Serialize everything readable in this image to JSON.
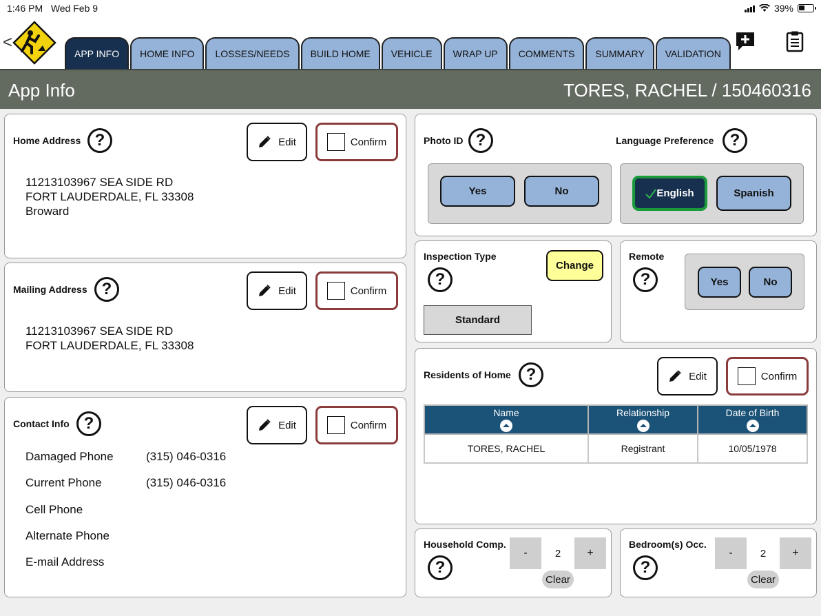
{
  "status": {
    "time": "1:46 PM",
    "date": "Wed Feb 9",
    "battery": "39%"
  },
  "nav": {
    "back": "<",
    "tabs": [
      "APP INFO",
      "HOME INFO",
      "LOSSES/NEEDS",
      "BUILD HOME",
      "VEHICLE",
      "WRAP UP",
      "COMMENTS",
      "SUMMARY",
      "VALIDATION"
    ],
    "active_tab": "APP INFO",
    "icons": [
      "add-comment-icon",
      "clipboard-icon"
    ]
  },
  "header": {
    "title": "App Info",
    "person": "TORES, RACHEL / 150460316"
  },
  "common": {
    "edit": "Edit",
    "confirm": "Confirm",
    "help": "?"
  },
  "home_address": {
    "label": "Home Address",
    "line1": "11213103967 SEA SIDE RD",
    "line2": "FORT LAUDERDALE, FL 33308",
    "line3": "Broward"
  },
  "mailing_address": {
    "label": "Mailing Address",
    "line1": "11213103967 SEA SIDE RD",
    "line2": "FORT LAUDERDALE, FL 33308"
  },
  "contact": {
    "label": "Contact Info",
    "rows": [
      {
        "label": "Damaged Phone",
        "value": "(315) 046-0316"
      },
      {
        "label": "Current Phone",
        "value": "(315) 046-0316"
      },
      {
        "label": "Cell Phone",
        "value": ""
      },
      {
        "label": "Alternate Phone",
        "value": ""
      },
      {
        "label": "E-mail Address",
        "value": ""
      }
    ]
  },
  "photo_id": {
    "label": "Photo ID",
    "yes": "Yes",
    "no": "No"
  },
  "language": {
    "label": "Language Preference",
    "english": "English",
    "spanish": "Spanish",
    "selected": "English"
  },
  "inspection": {
    "label": "Inspection Type",
    "change": "Change",
    "value": "Standard"
  },
  "remote": {
    "label": "Remote",
    "yes": "Yes",
    "no": "No"
  },
  "residents": {
    "label": "Residents of Home",
    "columns": [
      "Name",
      "Relationship",
      "Date of Birth"
    ],
    "rows": [
      [
        "TORES, RACHEL",
        "Registrant",
        "10/05/1978"
      ]
    ]
  },
  "household": {
    "label": "Household Comp.",
    "minus": "-",
    "value": "2",
    "plus": "+",
    "clear": "Clear"
  },
  "bedrooms": {
    "label": "Bedroom(s) Occ.",
    "minus": "-",
    "value": "2",
    "plus": "+",
    "clear": "Clear"
  },
  "colors": {
    "tab": "#95b3d8",
    "tab_active": "#17304f",
    "header": "#636b61",
    "confirm_border": "#8a3b3b",
    "table_header": "#1b5277",
    "selected_border": "#1a9a3a",
    "change": "#ffff99"
  }
}
